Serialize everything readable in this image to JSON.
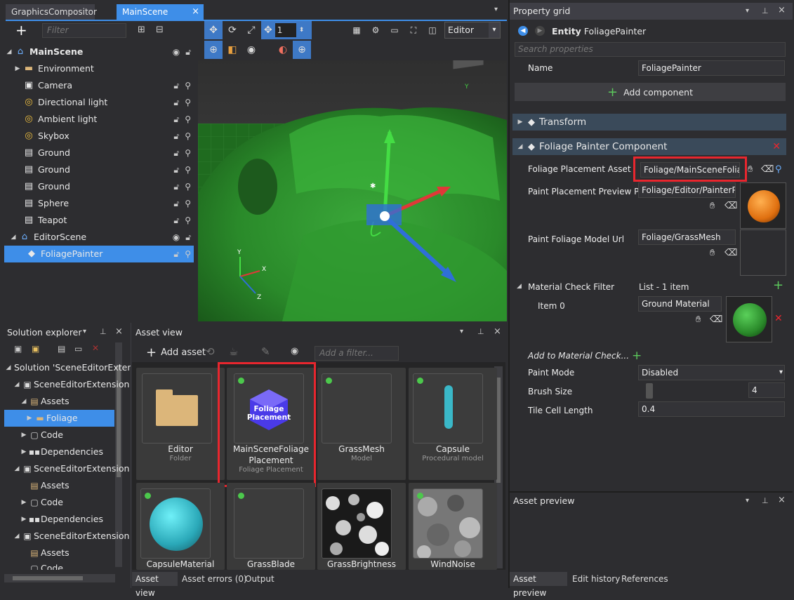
{
  "tabs": {
    "compositor": "GraphicsCompositor",
    "scene": "MainScene",
    "scene_close": "×",
    "overflow": "▾"
  },
  "scene_tree": {
    "filter_placeholder": "Filter",
    "add": "+",
    "items": [
      {
        "label": "MainScene"
      },
      {
        "label": "Environment"
      },
      {
        "label": "Camera"
      },
      {
        "label": "Directional light"
      },
      {
        "label": "Ambient light"
      },
      {
        "label": "Skybox"
      },
      {
        "label": "Ground"
      },
      {
        "label": "Ground"
      },
      {
        "label": "Ground"
      },
      {
        "label": "Sphere"
      },
      {
        "label": "Teapot"
      },
      {
        "label": "EditorScene"
      },
      {
        "label": "FoliagePainter"
      }
    ]
  },
  "viewport": {
    "snap_value": "1",
    "camera_mode": "Editor",
    "axis_x": "X",
    "axis_y": "Y",
    "axis_z": "Z",
    "gizmo_x": "X",
    "gizmo_y": "Y"
  },
  "solution_explorer": {
    "title": "Solution explorer",
    "items": [
      {
        "label": "Solution 'SceneEditorExtens"
      },
      {
        "label": "SceneEditorExtension"
      },
      {
        "label": "Assets"
      },
      {
        "label": "Foliage"
      },
      {
        "label": "Code"
      },
      {
        "label": "Dependencies"
      },
      {
        "label": "SceneEditorExtension"
      },
      {
        "label": "Assets"
      },
      {
        "label": "Code"
      },
      {
        "label": "Dependencies"
      },
      {
        "label": "SceneEditorExtension"
      },
      {
        "label": "Assets"
      },
      {
        "label": "Code"
      }
    ]
  },
  "asset_view": {
    "title": "Asset view",
    "add_asset": "Add asset",
    "filter_placeholder": "Add a filter...",
    "cards": [
      {
        "name": "Editor",
        "type": "Folder"
      },
      {
        "name": "MainSceneFoliage Placement",
        "type": "Foliage Placement",
        "thumb_text": "Foliage Placement"
      },
      {
        "name": "GrassMesh",
        "type": "Model"
      },
      {
        "name": "Capsule",
        "type": "Procedural model"
      },
      {
        "name": "CapsuleMaterial",
        "type": ""
      },
      {
        "name": "GrassBlade",
        "type": ""
      },
      {
        "name": "GrassBrightness",
        "type": ""
      },
      {
        "name": "WindNoise",
        "type": ""
      }
    ],
    "bottom_tabs": [
      "Asset view",
      "Asset errors (0)",
      "Output"
    ]
  },
  "property_grid": {
    "title": "Property grid",
    "entity_prefix": "Entity",
    "entity_name": "FoliagePainter",
    "search_placeholder": "Search properties",
    "name_label": "Name",
    "name_value": "FoliagePainter",
    "add_component": "Add component",
    "transform": "Transform",
    "component": "Foliage Painter Component",
    "foliage_placement_label": "Foliage Placement Asset",
    "foliage_placement_value": "Foliage/MainSceneFoliage",
    "paint_preview_label": "Paint Placement Preview P...",
    "paint_preview_value": "Foliage/Editor/PainterPre",
    "model_url_label": "Paint Foliage Model Url",
    "model_url_value": "Foliage/GrassMesh",
    "material_filter_label": "Material Check Filter",
    "material_filter_value": "List - 1 item",
    "item0_label": "Item 0",
    "item0_value": "Ground Material",
    "add_to_filter": "Add to Material Check...",
    "paint_mode_label": "Paint Mode",
    "paint_mode_value": "Disabled",
    "brush_size_label": "Brush Size",
    "brush_size_value": "4",
    "tile_cell_label": "Tile Cell Length",
    "tile_cell_value": "0.4"
  },
  "asset_preview": {
    "title": "Asset preview",
    "bottom_tabs": [
      "Asset preview",
      "Edit history",
      "References"
    ]
  },
  "colors": {
    "accent": "#3e8ee8",
    "highlight": "#e8262e",
    "panel": "#2d2d30"
  }
}
